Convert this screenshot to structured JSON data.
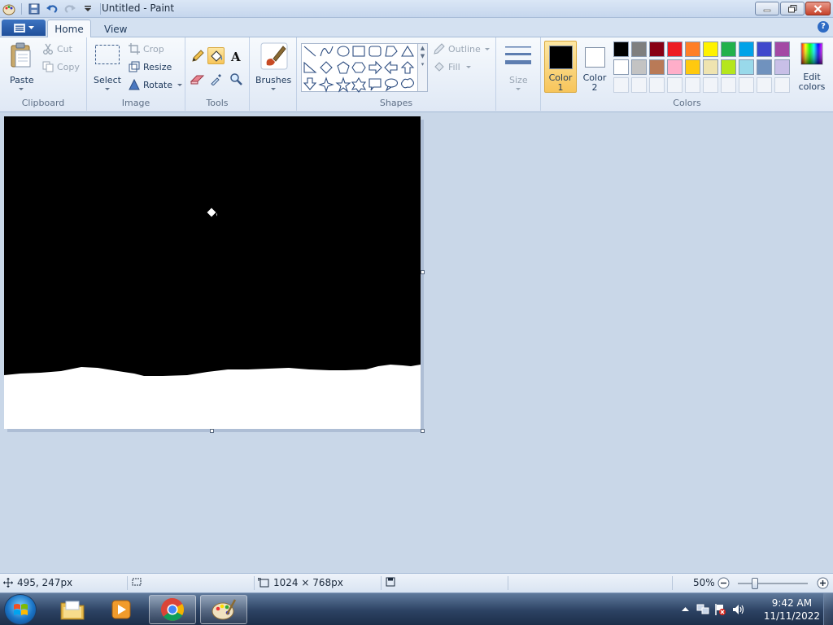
{
  "window": {
    "title": "Untitled - Paint"
  },
  "tabs": {
    "home": "Home",
    "view": "View"
  },
  "ribbon": {
    "clipboard": {
      "group": "Clipboard",
      "paste": "Paste",
      "cut": "Cut",
      "copy": "Copy"
    },
    "image": {
      "group": "Image",
      "select": "Select",
      "crop": "Crop",
      "resize": "Resize",
      "rotate": "Rotate"
    },
    "tools": {
      "group": "Tools",
      "selected": "fill-tool"
    },
    "brushes": {
      "label": "Brushes"
    },
    "shapes": {
      "group": "Shapes",
      "outline": "Outline",
      "fill": "Fill"
    },
    "size": {
      "label": "Size"
    },
    "colors": {
      "group": "Colors",
      "color1_line1": "Color",
      "color1_line2": "1",
      "color2_line1": "Color",
      "color2_line2": "2",
      "color1_value": "#000000",
      "color2_value": "#ffffff",
      "edit_line1": "Edit",
      "edit_line2": "colors",
      "palette_row1": [
        "#000000",
        "#7f7f7f",
        "#880015",
        "#ed1c24",
        "#ff7f27",
        "#fff200",
        "#22b14c",
        "#00a2e8",
        "#3f48cc",
        "#a349a4"
      ],
      "palette_row2": [
        "#ffffff",
        "#c3c3c3",
        "#b97a57",
        "#ffaec9",
        "#ffc90e",
        "#efe4b0",
        "#b5e61d",
        "#99d9ea",
        "#7092be",
        "#c8bfe7"
      ]
    }
  },
  "canvas": {
    "background": "#000000",
    "ground_color": "#ffffff"
  },
  "status": {
    "cursor_pos": "495, 247px",
    "selection_size": "",
    "image_size": "1024 × 768px",
    "zoom": "50%"
  },
  "taskbar": {
    "apps": [
      "file-explorer",
      "media-player",
      "chrome",
      "paint"
    ],
    "time": "9:42 AM",
    "date": "11/11/2022"
  }
}
